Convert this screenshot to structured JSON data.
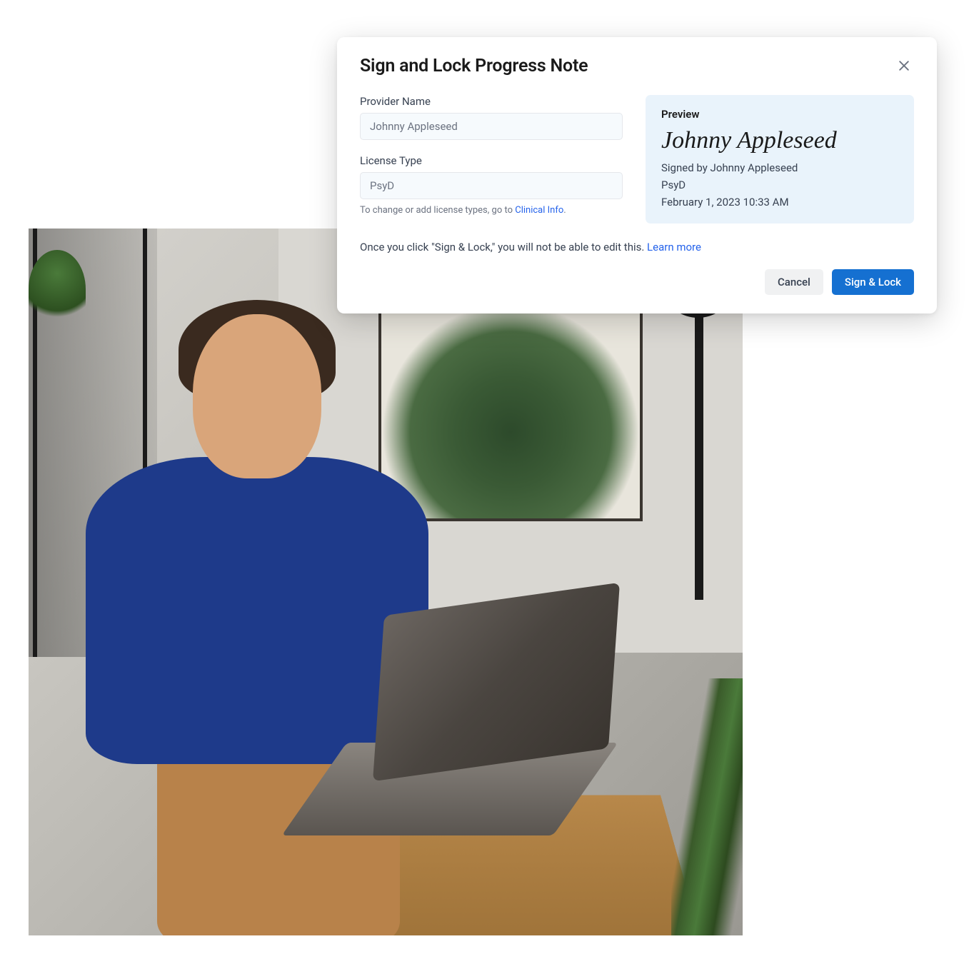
{
  "dialog": {
    "title": "Sign and Lock Progress Note",
    "form": {
      "providerName": {
        "label": "Provider Name",
        "value": "Johnny Appleseed"
      },
      "licenseType": {
        "label": "License Type",
        "value": "PsyD",
        "helperPrefix": "To change or add license types, go to ",
        "helperLink": "Clinical Info",
        "helperSuffix": "."
      }
    },
    "preview": {
      "label": "Preview",
      "signature": "Johnny Appleseed",
      "signedBy": "Signed by Johnny Appleseed",
      "license": "PsyD",
      "timestamp": "February 1, 2023 10:33 AM"
    },
    "warning": {
      "text": "Once you click \"Sign & Lock,\" you will not be able to edit this. ",
      "learnMore": "Learn more"
    },
    "buttons": {
      "cancel": "Cancel",
      "signLock": "Sign & Lock"
    }
  }
}
